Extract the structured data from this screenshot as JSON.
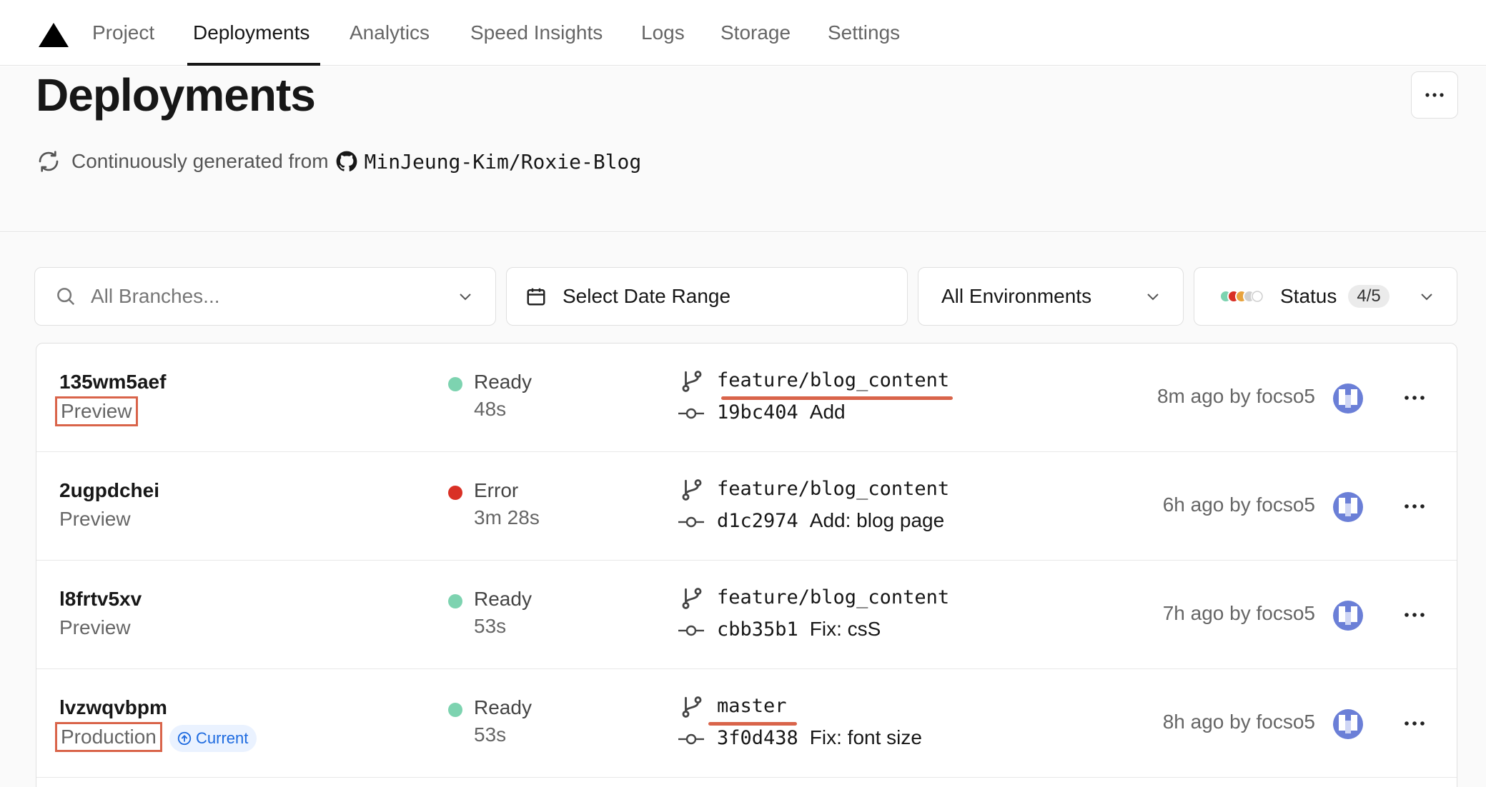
{
  "nav": {
    "tabs": [
      {
        "label": "Project"
      },
      {
        "label": "Deployments"
      },
      {
        "label": "Analytics"
      },
      {
        "label": "Speed Insights"
      },
      {
        "label": "Logs"
      },
      {
        "label": "Storage"
      },
      {
        "label": "Settings"
      }
    ],
    "active": "Deployments"
  },
  "header": {
    "title": "Deployments",
    "source_prefix": "Continuously generated from",
    "repo": "MinJeung-Kim/Roxie-Blog"
  },
  "filters": {
    "branches_placeholder": "All Branches...",
    "date_range": "Select Date Range",
    "environments": "All Environments",
    "status_label": "Status",
    "status_count": "4/5",
    "status_colors": [
      "#7dd3b0",
      "#d93025",
      "#e8a33d",
      "#d0d0d0",
      "#ffffff"
    ]
  },
  "deployments": [
    {
      "id": "135wm5aef",
      "environment": "Preview",
      "status": "Ready",
      "status_color": "#7dd3b0",
      "duration": "48s",
      "branch": "feature/blog_content",
      "commit_hash": "19bc404",
      "commit_msg": "Add",
      "time": "8m ago by focso5"
    },
    {
      "id": "2ugpdchei",
      "environment": "Preview",
      "status": "Error",
      "status_color": "#d93025",
      "duration": "3m 28s",
      "branch": "feature/blog_content",
      "commit_hash": "d1c2974",
      "commit_msg": "Add: blog page",
      "time": "6h ago by focso5"
    },
    {
      "id": "l8frtv5xv",
      "environment": "Preview",
      "status": "Ready",
      "status_color": "#7dd3b0",
      "duration": "53s",
      "branch": "feature/blog_content",
      "commit_hash": "cbb35b1",
      "commit_msg": "Fix: csS",
      "time": "7h ago by focso5"
    },
    {
      "id": "lvzwqvbpm",
      "environment": "Production",
      "current_label": "Current",
      "status": "Ready",
      "status_color": "#7dd3b0",
      "duration": "53s",
      "branch": "master",
      "commit_hash": "3f0d438",
      "commit_msg": "Fix: font size",
      "time": "8h ago by focso5"
    }
  ],
  "accent": "#d9644a"
}
